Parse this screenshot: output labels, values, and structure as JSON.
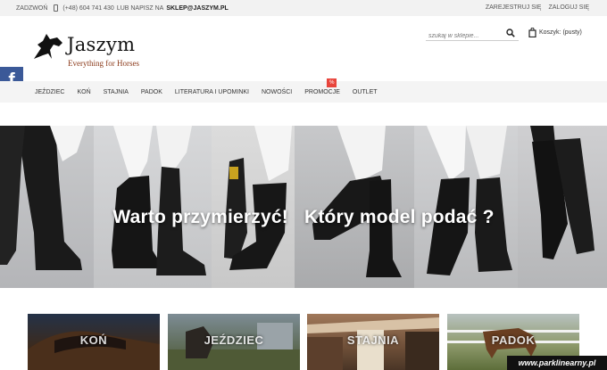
{
  "topbar": {
    "call_label": "ZADZWOŃ",
    "phone": "(+48) 604 741 430",
    "or_write": "LUB NAPISZ NA",
    "email": "SKLEP@JASZYM.PL",
    "register": "ZAREJESTRUJ SIĘ",
    "login": "ZALOGUJ SIĘ"
  },
  "logo": {
    "brand": "Jaszym",
    "tagline": "Everything for Horses"
  },
  "search": {
    "placeholder": "szukaj w sklepie..."
  },
  "cart": {
    "label": "Koszyk: (pusty)"
  },
  "facebook": {
    "glyph": "f"
  },
  "nav": {
    "items": [
      "JEŹDZIEC",
      "KOŃ",
      "STAJNIA",
      "PADOK",
      "LITERATURA I UPOMINKI",
      "NOWOŚCI",
      "PROMOCJE",
      "OUTLET"
    ],
    "promo_badge": "%"
  },
  "hero": {
    "caption_left": "Warto przymierzyć!",
    "caption_right": "Który model podać ?"
  },
  "categories": [
    {
      "label": "KOŃ"
    },
    {
      "label": "JEŹDZIEC"
    },
    {
      "label": "STAJNIA"
    },
    {
      "label": "PADOK"
    }
  ],
  "watermark": "www.parklinearny.pl",
  "colors": {
    "accent_red": "#e8453c",
    "facebook_blue": "#3b5998",
    "tagline_brown": "#8b3a1a"
  }
}
